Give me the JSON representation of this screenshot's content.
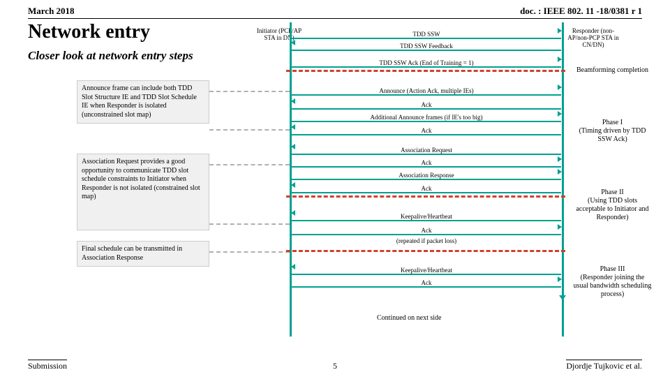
{
  "header": {
    "left": "March 2018",
    "right": "doc. : IEEE 802. 11 -18/0381 r 1"
  },
  "title": "Network entry",
  "subtitle": "Closer look at network entry steps",
  "initiator": "Initiator (PCP/AP STA in DN)",
  "responder": "Responder (non-AP/non-PCP STA in CN/DN)",
  "notes": {
    "n1": "Announce frame can include both TDD Slot Structure IE and TDD Slot Schedule IE when Responder is isolated (unconstrained slot map)",
    "n2": "Association Request provides a good opportunity to communicate TDD slot schedule constraints to Initiator when Responder is not isolated (constrained slot map)",
    "n3": "Final schedule can be transmitted in Association Response"
  },
  "msgs": {
    "m1": "TDD SSW",
    "m2": "TDD SSW Feedback",
    "m3": "TDD SSW Ack (End of Training = 1)",
    "m4": "Announce (Action Ack, multiple IEs)",
    "m5": "Ack",
    "m6": "Additional Announce frames (if IE's too big)",
    "m7": "Ack",
    "m8": "Association Request",
    "m9": "Ack",
    "m10": "Association Response",
    "m11": "Ack",
    "m12": "Keepalive/Heartbeat",
    "m13": "Ack",
    "m14": "(repeated if packet loss)",
    "m15": "Keepalive/Heartbeat",
    "m16": "Ack"
  },
  "side": {
    "s1": "Beamforming completion",
    "s2": "Phase I\n(Timing driven by TDD SSW Ack)",
    "s3": "Phase II\n(Using TDD slots acceptable to Initiator and Responder)",
    "s4": "Phase III\n(Responder joining the usual bandwidth scheduling process)"
  },
  "continued": "Continued on next side",
  "footer": {
    "left": "Submission",
    "center": "5",
    "right": "Djordje Tujkovic et al."
  }
}
